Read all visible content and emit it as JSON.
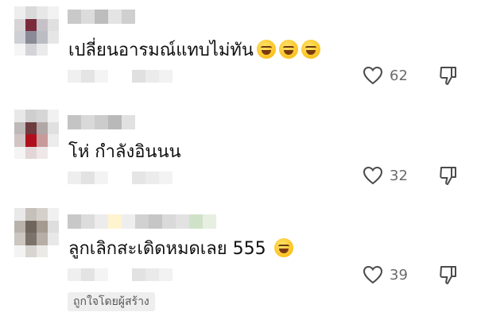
{
  "comments": [
    {
      "text": "เปลี่ยนอารมณ์แทบไม่ทัน",
      "emojis": [
        "rolling-on-floor-laughing",
        "rolling-on-floor-laughing",
        "rolling-on-floor-laughing"
      ],
      "likes": "62"
    },
    {
      "text": "โห่ กำลังอินนน",
      "emojis": [],
      "likes": "32"
    },
    {
      "text": "ลูกเลิกสะเดิดหมดเลย 555",
      "emojis": [
        "face-with-tears-of-joy"
      ],
      "likes": "39",
      "creator_badge": "ถูกใจโดยผู้สร้าง"
    }
  ],
  "icons": {
    "like": "heart-outline-icon",
    "dislike": "thumbs-down-outline-icon"
  },
  "colors": {
    "text": "#161823",
    "count": "#6b6b6b",
    "badge_bg": "#eeeeee"
  }
}
